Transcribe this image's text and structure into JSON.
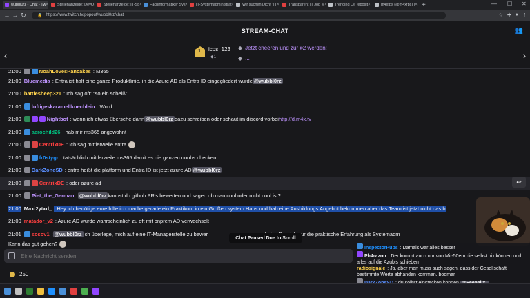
{
  "browser": {
    "tabs": [
      {
        "label": "wubbl0rz - Chat - Tw",
        "color": "#9146ff",
        "active": true
      },
      {
        "label": "Stellenanzeige: DevO",
        "color": "#e04040"
      },
      {
        "label": "Stellenanzeige: IT-Sp",
        "color": "#e04040"
      },
      {
        "label": "Fachinformatiker Sys",
        "color": "#4a90d9"
      },
      {
        "label": "IT-Systemadministrat",
        "color": "#e04040"
      },
      {
        "label": "Wir suchen Dich! \"IT",
        "color": "#bdc1c6"
      },
      {
        "label": "Transparent IT Job M",
        "color": "#e04040"
      },
      {
        "label": "Trending C# reposit",
        "color": "#bdc1c6"
      },
      {
        "label": "m4xfps (@m4xfps) |",
        "color": "#bdc1c6"
      }
    ],
    "url": "https://www.twitch.tv/popout/wubbl0rz/chat"
  },
  "header": {
    "title": "STREAM-CHAT"
  },
  "hype": {
    "top_user": "icos_123",
    "top_rank": "1",
    "top_count": "1",
    "cheer_line1": "Jetzt cheeren und zur #2 werden!",
    "cheer_line2": "..."
  },
  "chat": [
    {
      "ts": "21:00",
      "user": "NoahLovesPancakes",
      "color": "#ffd34d",
      "badges": [
        "b-gray",
        "b-blue"
      ],
      "text": ": M365",
      "first": true
    },
    {
      "ts": "21:00",
      "user": "Bluemedia",
      "color": "#bf94ff",
      "badges": [],
      "text": ": Entra ist halt eine ganze Produktlinie, in die Azure AD als Entra ID eingegliedert wurde",
      "mention": "@wubbl0rz"
    },
    {
      "ts": "21:00",
      "user": "battlesheep321",
      "color": "#ffd34d",
      "badges": [],
      "text": ": Ich sag oft: \"so ein scheiß\""
    },
    {
      "ts": "21:00",
      "user": "luftigeskaramellkuechlein",
      "color": "#bf94ff",
      "badges": [
        "b-blue"
      ],
      "text": ": Word"
    },
    {
      "ts": "21:00",
      "user": "Nightbot",
      "color": "#bf94ff",
      "badges": [
        "b-green",
        "b-purple",
        "b-purple"
      ],
      "text": ": wenn ich etwas übersehe dann",
      "mention": "@wubbl0rz",
      "after": " dazu schreiben oder schaut im discord vorbei ",
      "link": "http://d.m4x.tv"
    },
    {
      "ts": "21:00",
      "user": "aerochild26",
      "color": "#00c080",
      "badges": [
        "b-blue"
      ],
      "text": ": hab mir ms365 angewohnt"
    },
    {
      "ts": "21:00",
      "user": "CentrixDE",
      "color": "#ff4040",
      "badges": [
        "b-gray",
        "b-red"
      ],
      "text": ": Ich sag mittlerweile entra",
      "emote": true
    },
    {
      "ts": "21:00",
      "user": "fr0stygr",
      "color": "#1e90ff",
      "badges": [
        "b-gray",
        "b-blue"
      ],
      "text": ": tatsächlich mittlerweile ms365 damit es die ganzen noobs checken"
    },
    {
      "ts": "21:00",
      "user": "DarkZoneSD",
      "color": "#5a8fff",
      "badges": [
        "b-gray"
      ],
      "text": ": entra heißt die platform und Entra ID ist jetzt azure AD",
      "mention": "@wubbl0rz"
    },
    {
      "ts": "21:00",
      "user": "CentrixDE",
      "color": "#ff4040",
      "badges": [
        "b-gray",
        "b-red"
      ],
      "text": ": oder azure ad",
      "hl": true
    },
    {
      "ts": "21:00",
      "user": "Piet_the_German",
      "color": "#bf94ff",
      "badges": [
        "b-gray"
      ],
      "text": ":",
      "mention": "@wubbl0rz",
      "after": " kannst du github PR's bewerten und sagen ob man cool oder nicht cool ist?"
    },
    {
      "ts": "21:00",
      "user": "Maxi2ytxd_",
      "color": "#efeff1",
      "badges": [],
      "text": ": Hey ich benötige eure hilfe ich mache gerade ein Praktikum in ein Großen system Haus und hab eine Ausbildungs Angebot bekommen aber das Team ist jetzt nicht das b",
      "sel": true
    },
    {
      "ts": "21:00",
      "user": "matador_v2",
      "color": "#ff4040",
      "badges": [],
      "text": ": Azure AD wurde wahrscheinlich zu oft mit onprem AD verwechselt"
    },
    {
      "ts": "21:01",
      "user": "sosov1",
      "color": "#ff4040",
      "badges": [
        "b-blue"
      ],
      "text": ":",
      "mention": "@wubbl0rz",
      "after": " Ich überlege, mich auf eine IT-Managerstelle zu bewer",
      "tail": "derten Bereich nur die praktische Erfahrung als Systemadm"
    },
    {
      "ts": "",
      "user": "",
      "color": "#efeff1",
      "badges": [],
      "text": "Kann das gut gehen?",
      "emote": true,
      "cont": true
    }
  ],
  "pause_label": "Chat Paused Due to Scroll",
  "input": {
    "placeholder": "Eine Nachricht senden"
  },
  "points": "250",
  "overlay": [
    {
      "user": "InspectorPups",
      "color": "#1e90ff",
      "text": ": Damals war alles besser",
      "badge": "b-blue"
    },
    {
      "user": "Ph4razon",
      "color": "#efeff1",
      "text": ": Der kommt auch nur von Mit-50em die selbst nix können und alles auf die Azubis schieben",
      "badge": "b-purple"
    },
    {
      "user": "radiosignale",
      "color": "#ffd34d",
      "text": ": Ja, aber man muss auch sagen, dass der Gesellschaft bestimmte Werte abhanden kommen. boomer",
      "badge": ""
    },
    {
      "user": "DarkZoneSD",
      "color": "#5a8fff",
      "text": ": du solltst einstecken können",
      "mention": "@Feeeelix_",
      "badge": "b-gray"
    }
  ]
}
